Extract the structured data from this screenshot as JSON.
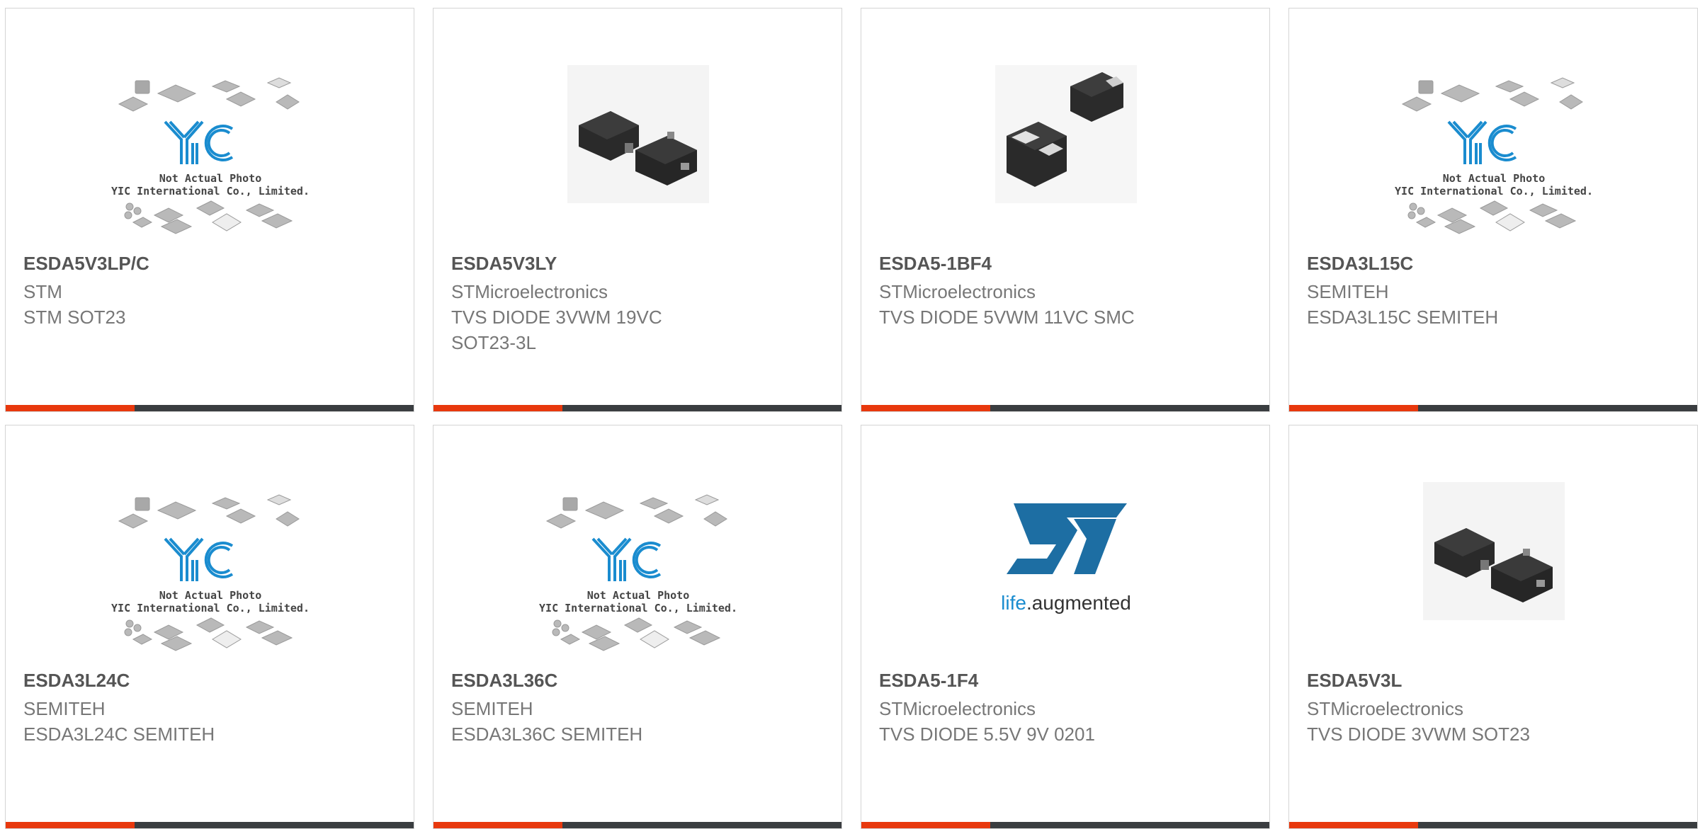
{
  "products": [
    {
      "name": "ESDA5V3LP/C",
      "maker": "STM",
      "desc": [
        "STM SOT23"
      ],
      "image": "yic-placeholder"
    },
    {
      "name": "ESDA5V3LY",
      "maker": "STMicroelectronics",
      "desc": [
        "TVS DIODE 3VWM 19VC",
        "SOT23-3L"
      ],
      "image": "sot23-chip"
    },
    {
      "name": "ESDA5-1BF4",
      "maker": "STMicroelectronics",
      "desc": [
        "TVS DIODE 5VWM 11VC SMC"
      ],
      "image": "smd-blocks"
    },
    {
      "name": "ESDA3L15C",
      "maker": "SEMITEH",
      "desc": [
        "ESDA3L15C SEMITEH"
      ],
      "image": "yic-placeholder"
    },
    {
      "name": "ESDA3L24C",
      "maker": "SEMITEH",
      "desc": [
        "ESDA3L24C SEMITEH"
      ],
      "image": "yic-placeholder"
    },
    {
      "name": "ESDA3L36C",
      "maker": "SEMITEH",
      "desc": [
        "ESDA3L36C SEMITEH"
      ],
      "image": "yic-placeholder"
    },
    {
      "name": "ESDA5-1F4",
      "maker": "STMicroelectronics",
      "desc": [
        "TVS DIODE 5.5V 9V 0201"
      ],
      "image": "st-logo"
    },
    {
      "name": "ESDA5V3L",
      "maker": "STMicroelectronics",
      "desc": [
        "TVS DIODE 3VWM SOT23"
      ],
      "image": "sot23-chip"
    }
  ],
  "placeholder": {
    "brand": "YIC",
    "caption_line1": "Not Actual Photo",
    "caption_line2": "YIC International Co., Limited."
  },
  "st_logo": {
    "tagline_part1": "life",
    "tagline_part2": ".augmented"
  },
  "colors": {
    "accent": "#e8380d",
    "bar": "#3a3d40",
    "title_text": "#555555",
    "desc_text": "#777777",
    "brand_blue": "#1a8ccf"
  }
}
